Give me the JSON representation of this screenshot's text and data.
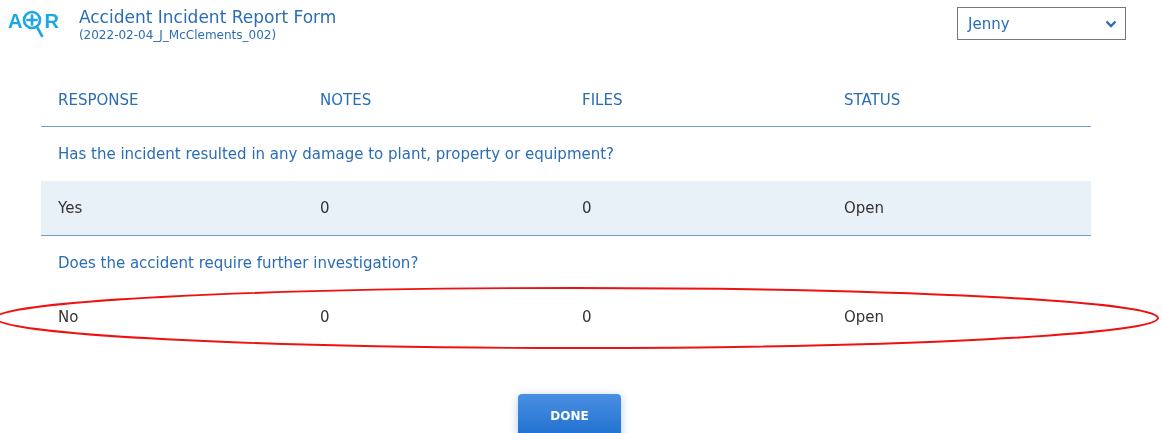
{
  "header": {
    "logo": {
      "left": "A",
      "right": "R"
    },
    "title": "Accident Incident Report Form",
    "subtitle": "(2022-02-04_J_McClements_002)",
    "user_select": {
      "value": "Jenny"
    }
  },
  "table": {
    "columns": [
      "RESPONSE",
      "NOTES",
      "FILES",
      "STATUS"
    ],
    "sections": [
      {
        "question": "Has the incident resulted in any damage to plant, property or equipment?",
        "answer": {
          "cells": [
            "Yes",
            "0",
            "0",
            "Open"
          ],
          "shaded": true,
          "circled": false
        }
      },
      {
        "question": "Does the accident require further investigation?",
        "answer": {
          "cells": [
            "No",
            "0",
            "0",
            "Open"
          ],
          "shaded": false,
          "circled": true
        }
      }
    ]
  },
  "done_button": "DONE"
}
